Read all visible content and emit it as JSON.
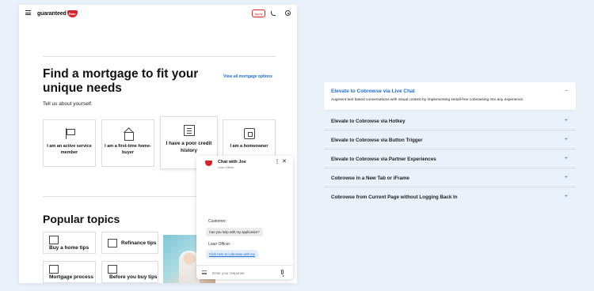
{
  "site": {
    "logo_text": "guaranteed",
    "logo_mark": "Rate",
    "apply_label": "Apply",
    "hero_title": "Find a mortgage to fit your unique needs",
    "all_options_link": "View all mortgage options",
    "tell_us": "Tell us about yourself.",
    "cards": [
      {
        "label": "I am an active service member",
        "icon": "flag-icon"
      },
      {
        "label": "I am a first-time home-buyer",
        "icon": "house-icon"
      },
      {
        "label": "I have a poor credit history",
        "icon": "document-icon"
      },
      {
        "label": "I am a homeowner",
        "icon": "home-icon"
      }
    ],
    "popular_title": "Popular topics",
    "topics": [
      {
        "label": "Buy a home tips",
        "icon": "house-outline-icon"
      },
      {
        "label": "Refinance tips",
        "icon": "refinance-icon"
      },
      {
        "label": "Mortgage process",
        "icon": "checklist-icon"
      },
      {
        "label": "Before you buy tips",
        "icon": "clipboard-icon"
      }
    ]
  },
  "chat": {
    "title": "Chat with Joe",
    "subtitle": "Loan Officer",
    "customer_label": "Customer:",
    "customer_message": "Can you help with my application?",
    "officer_label": "Loan Officer:",
    "officer_message": "Click here to cobrowse with me",
    "input_placeholder": "Enter your response"
  },
  "accordion": {
    "open_item": {
      "title": "Elevate to Cobrowse via Live Chat",
      "body": "Augment text based conversations with visual context by implementing install-free cobrowsing into any experience."
    },
    "items": [
      "Elevate to Cobrowse via Hotkey",
      "Elevate to Cobrowse via Button Trigger",
      "Elevate to Cobrowse via Partner Experiences",
      "Cobrowse in a New Tab or iFrame",
      "Cobrowse from Current Page without Logging Back In"
    ]
  },
  "colors": {
    "brand_red": "#d92228",
    "link_blue": "#1f6fd6",
    "background": "#e9f1fa"
  }
}
